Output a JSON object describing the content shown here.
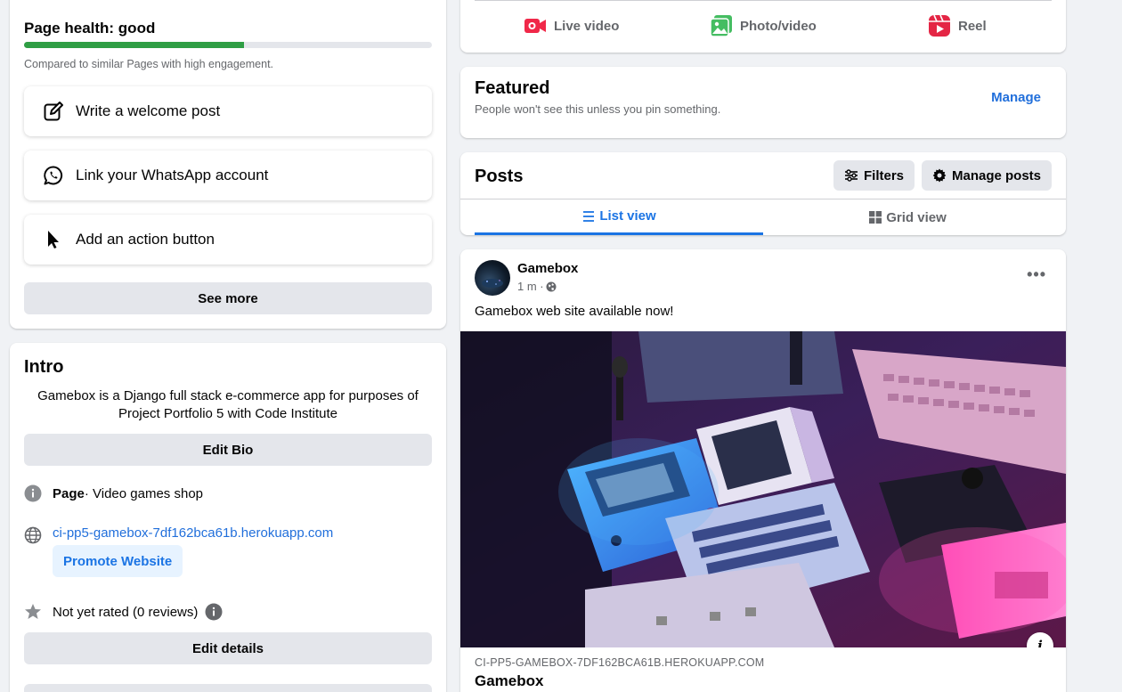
{
  "health": {
    "title": "Page health: good",
    "progress_percent": 54,
    "note": "Compared to similar Pages with high engagement.",
    "bar_color": "#2f9e44"
  },
  "tasks": [
    {
      "label": "Write a welcome post",
      "icon": "edit-icon"
    },
    {
      "label": "Link your WhatsApp account",
      "icon": "whatsapp-icon"
    },
    {
      "label": "Add an action button",
      "icon": "cursor-icon"
    }
  ],
  "see_more_label": "See more",
  "intro": {
    "title": "Intro",
    "bio": "Gamebox is a Django full stack e-commerce app for purposes of Project Portfolio 5 with Code Institute",
    "edit_bio_label": "Edit Bio",
    "page_type_label": "Page",
    "page_category": " · Video games shop",
    "website": "ci-pp5-gamebox-7df162bca61b.herokuapp.com",
    "promote_label": "Promote Website",
    "rating": "Not yet rated (0 reviews)",
    "edit_details_label": "Edit details"
  },
  "composer": {
    "live_label": "Live video",
    "photo_label": "Photo/video",
    "reel_label": "Reel"
  },
  "featured": {
    "title": "Featured",
    "subtitle": "People won't see this unless you pin something.",
    "manage_label": "Manage"
  },
  "posts": {
    "title": "Posts",
    "filters_label": "Filters",
    "manage_label": "Manage posts",
    "list_view_label": "List view",
    "grid_view_label": "Grid view"
  },
  "post": {
    "author": "Gamebox",
    "time": "1 m · ",
    "text": "Gamebox web site available now!",
    "link_domain": "CI-PP5-GAMEBOX-7DF162BCA61B.HEROKUAPP.COM",
    "link_title": "Gamebox"
  },
  "colors": {
    "accent": "#1b74e4",
    "link": "#216fdb",
    "button_gray": "#e4e6eb",
    "background": "#f0f2f5"
  }
}
